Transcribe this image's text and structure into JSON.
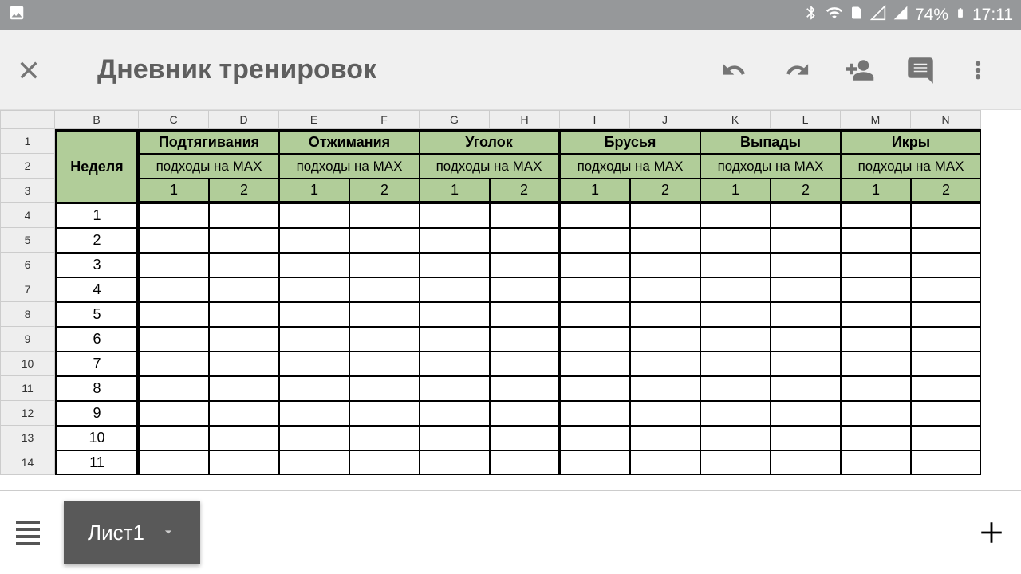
{
  "status": {
    "battery": "74%",
    "time": "17:11"
  },
  "app": {
    "title": "Дневник тренировок"
  },
  "columns": [
    "B",
    "C",
    "D",
    "E",
    "F",
    "G",
    "H",
    "I",
    "J",
    "K",
    "L",
    "M",
    "N"
  ],
  "colWidth": {
    "B": 105,
    "other": 88
  },
  "rows": [
    "1",
    "2",
    "3",
    "4",
    "5",
    "6",
    "7",
    "8",
    "9",
    "10",
    "11",
    "12",
    "13",
    "14"
  ],
  "header": {
    "week": "Неделя",
    "exercises": [
      "Подтягивания",
      "Отжимания",
      "Уголок",
      "Брусья",
      "Выпады",
      "Икры"
    ],
    "sub": "подходы на MAX",
    "setNums": [
      "1",
      "2"
    ]
  },
  "weeks": [
    "1",
    "2",
    "3",
    "4",
    "5",
    "6",
    "7",
    "8",
    "9",
    "10",
    "11"
  ],
  "bottom": {
    "sheet": "Лист1"
  }
}
